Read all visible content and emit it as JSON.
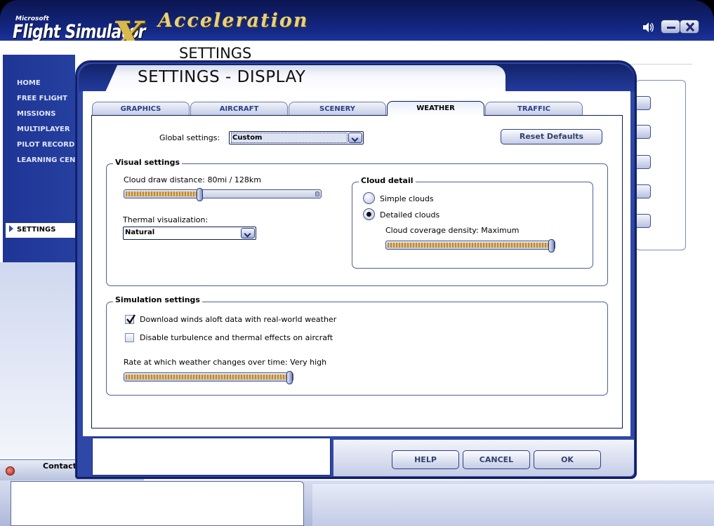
{
  "app": {
    "logo_microsoft": "Microsoft",
    "logo_product": "Flight Simulator",
    "logo_x": "X",
    "logo_edition": "Acceleration",
    "background_title": "SETTINGS"
  },
  "nav": {
    "items": [
      {
        "label": "HOME"
      },
      {
        "label": "FREE FLIGHT"
      },
      {
        "label": "MISSIONS"
      },
      {
        "label": "MULTIPLAYER"
      },
      {
        "label": "PILOT RECORDS"
      },
      {
        "label": "LEARNING CENTER"
      }
    ],
    "active": "SETTINGS"
  },
  "contacts": {
    "label": "Contacts"
  },
  "dialog": {
    "title": "SETTINGS - DISPLAY",
    "tabs": [
      {
        "label": "GRAPHICS",
        "active": false
      },
      {
        "label": "AIRCRAFT",
        "active": false
      },
      {
        "label": "SCENERY",
        "active": false
      },
      {
        "label": "WEATHER",
        "active": true
      },
      {
        "label": "TRAFFIC",
        "active": false
      }
    ],
    "global": {
      "label": "Global settings:",
      "value": "Custom",
      "reset_label": "Reset Defaults"
    },
    "visual": {
      "group_label": "Visual settings",
      "cloud_distance_label": "Cloud draw distance: 80mi / 128km",
      "cloud_distance_level": 0.38,
      "thermal_label": "Thermal visualization:",
      "thermal_value": "Natural",
      "cloud_detail": {
        "group_label": "Cloud detail",
        "options": [
          {
            "label": "Simple clouds",
            "selected": false
          },
          {
            "label": "Detailed clouds",
            "selected": true
          }
        ],
        "density_label": "Cloud coverage density: Maximum",
        "density_level": 1.0
      }
    },
    "simulation": {
      "group_label": "Simulation settings",
      "checkboxes": [
        {
          "label": "Download winds aloft data with real-world weather",
          "checked": true
        },
        {
          "label": "Disable turbulence and thermal effects on aircraft",
          "checked": false
        }
      ],
      "rate_label": "Rate at which weather changes over time: Very high",
      "rate_level": 1.0
    },
    "buttons": {
      "help": "HELP",
      "cancel": "CANCEL",
      "ok": "OK"
    }
  },
  "colors": {
    "frame_blue": "#2f48a8",
    "accent_gold": "#d7b94c",
    "slider_fill": "#b98a3a"
  }
}
